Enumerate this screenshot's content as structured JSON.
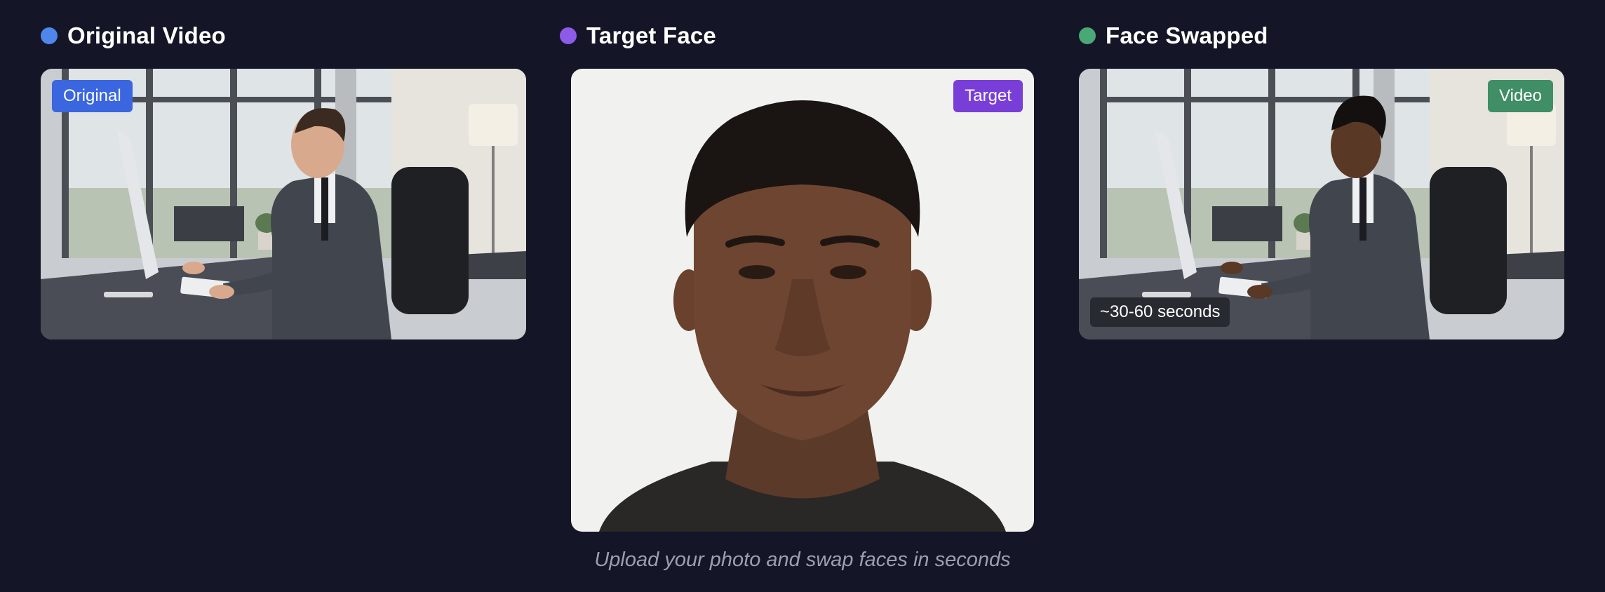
{
  "columns": [
    {
      "title": "Original Video",
      "dot_color": "#4f86ec",
      "badge": "Original",
      "badge_color": "#3a66e0"
    },
    {
      "title": "Target Face",
      "dot_color": "#8d5be8",
      "badge": "Target",
      "badge_color": "#7a3ed8"
    },
    {
      "title": "Face Swapped",
      "dot_color": "#4aa876",
      "badge": "Video",
      "badge_color": "#3f8e65",
      "duration": "~30-60 seconds"
    }
  ],
  "caption": "Upload your photo and swap faces in seconds"
}
